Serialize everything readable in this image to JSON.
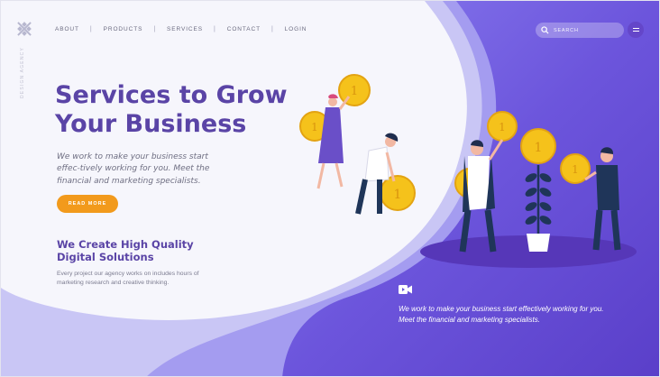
{
  "brand": {
    "tagline": "DESIGN AGENCY",
    "logo_icon": "snowflake-logo-icon"
  },
  "nav": {
    "items": [
      "ABOUT",
      "PRODUCTS",
      "SERVICES",
      "CONTACT",
      "LOGIN"
    ],
    "separator": "|"
  },
  "search": {
    "placeholder": "SEARCH",
    "icon": "search-icon"
  },
  "menu": {
    "icon": "hamburger-icon"
  },
  "hero": {
    "headline_line1": "Services to Grow",
    "headline_line2": "Your Business",
    "lede": "We work to make your business start effec-tively working for you. Meet the financial and marketing specialists.",
    "cta_label": "READ MORE"
  },
  "feature": {
    "title_line1": "We Create High Quality",
    "title_line2": "Digital Solutions",
    "text": "Every project our agency works on includes hours of marketing research and creative thinking."
  },
  "panel": {
    "icon": "video-camera-icon",
    "text_line1": "We work to make your business start effectively working for you.",
    "text_line2": "Meet the financial and marketing specialists."
  },
  "illustration": {
    "coin_label": "1"
  },
  "colors": {
    "accent": "#5a44a6",
    "panel_purple": "#6a54d6",
    "button_orange": "#f29a1c",
    "coin_gold": "#f5c21b"
  }
}
